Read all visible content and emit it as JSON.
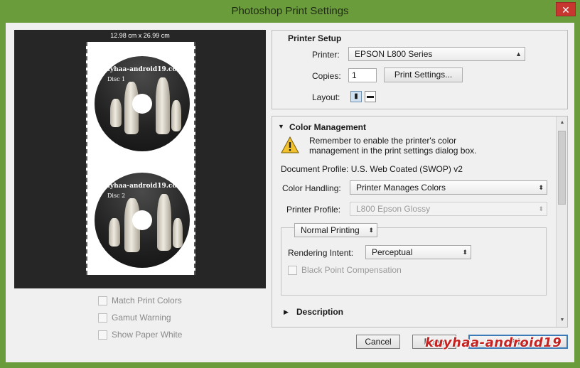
{
  "window": {
    "title": "Photoshop Print Settings",
    "close_glyph": "✕"
  },
  "preview": {
    "size_label": "12.98 cm x 26.99 cm",
    "discs": [
      {
        "title": "kuyhaa-android19.com",
        "label": "Disc 1"
      },
      {
        "title": "kuyhaa-android19.com",
        "label": "Disc 2"
      }
    ],
    "options": [
      {
        "label": "Match Print Colors",
        "checked": false
      },
      {
        "label": "Gamut Warning",
        "checked": false
      },
      {
        "label": "Show Paper White",
        "checked": false
      }
    ]
  },
  "printer_setup": {
    "heading": "Printer Setup",
    "printer_label": "Printer:",
    "printer_value": "EPSON L800 Series",
    "copies_label": "Copies:",
    "copies_value": "1",
    "print_settings_button": "Print Settings...",
    "layout_label": "Layout:",
    "layout_options": [
      "portrait-layout-icon",
      "landscape-layout-icon"
    ]
  },
  "color_management": {
    "heading": "Color Management",
    "toggle_glyph": "▼",
    "warning_text_line1": "Remember to enable the printer's color",
    "warning_text_line2": "management in the print settings dialog box.",
    "document_profile": "Document Profile: U.S. Web Coated (SWOP) v2",
    "color_handling_label": "Color Handling:",
    "color_handling_value": "Printer Manages Colors",
    "printer_profile_label": "Printer Profile:",
    "printer_profile_value": "L800 Epson Glossy",
    "printing_mode_value": "Normal Printing",
    "rendering_intent_label": "Rendering Intent:",
    "rendering_intent_value": "Perceptual",
    "black_point_label": "Black Point Compensation",
    "description_heading": "Description",
    "description_glyph": "▶"
  },
  "buttons": {
    "cancel": "Cancel",
    "done": "Done",
    "print": "Print"
  },
  "watermark": "kuyhaa-android19",
  "colors": {
    "window_frame": "#6a9c3c",
    "preview_bg": "#262626",
    "default_button_border": "#3d7ab8",
    "watermark": "#c52222"
  }
}
